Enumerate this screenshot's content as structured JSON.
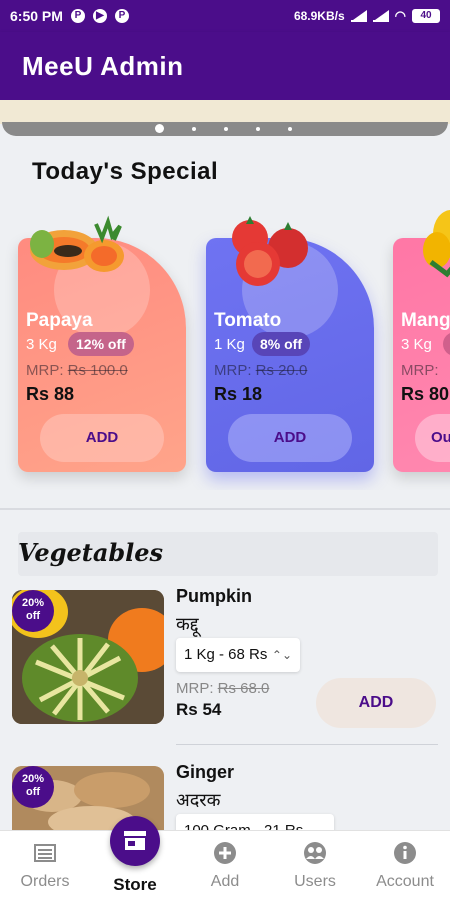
{
  "status_bar": {
    "time": "6:50 PM",
    "speed": "68.9KB/s",
    "battery": "40"
  },
  "app_bar": {
    "title": "MeeU Admin"
  },
  "carousel": {
    "dot_count": 5,
    "active_index": 0
  },
  "todays_special": {
    "title": "Today's Special",
    "cards": [
      {
        "name": "Papaya",
        "qty": "3 Kg",
        "off": "12% off",
        "mrp_label": "MRP:",
        "mrp_value": "Rs 100.0",
        "price": "Rs 88",
        "add_label": "ADD"
      },
      {
        "name": "Tomato",
        "qty": "1 Kg",
        "off": "8% off",
        "mrp_label": "MRP:",
        "mrp_value": "Rs 20.0",
        "price": "Rs 18",
        "add_label": "ADD"
      },
      {
        "name": "Mang",
        "qty": "3 Kg",
        "off": "",
        "mrp_label": "MRP:",
        "mrp_value": "",
        "price": "Rs 80",
        "add_label": "Ou"
      }
    ]
  },
  "vegetables": {
    "title": "Vegetables",
    "items": [
      {
        "badge_line1": "20%",
        "badge_line2": "off",
        "name": "Pumpkin",
        "local_name": "कद्दू",
        "selected_option": "1 Kg - 68 Rs",
        "mrp_label": "MRP:",
        "mrp_value": "Rs 68.0",
        "price": "Rs 54",
        "add_label": "ADD"
      },
      {
        "badge_line1": "20%",
        "badge_line2": "off",
        "name": "Ginger",
        "local_name": "अदरक",
        "selected_option": "100 Gram - 21 Rs",
        "mrp_label": "",
        "mrp_value": "",
        "price": "",
        "add_label": ""
      }
    ]
  },
  "bottom_nav": {
    "items": [
      {
        "label": "Orders",
        "icon": "orders-icon"
      },
      {
        "label": "Store",
        "icon": "store-icon"
      },
      {
        "label": "Add",
        "icon": "add-icon"
      },
      {
        "label": "Users",
        "icon": "users-icon"
      },
      {
        "label": "Account",
        "icon": "account-icon"
      }
    ],
    "active_index": 1
  },
  "colors": {
    "primary": "#4b0d8a",
    "papaya_card": "#ff8a80",
    "tomato_card": "#6a6ff0",
    "mango_card": "#ff6fa0"
  }
}
